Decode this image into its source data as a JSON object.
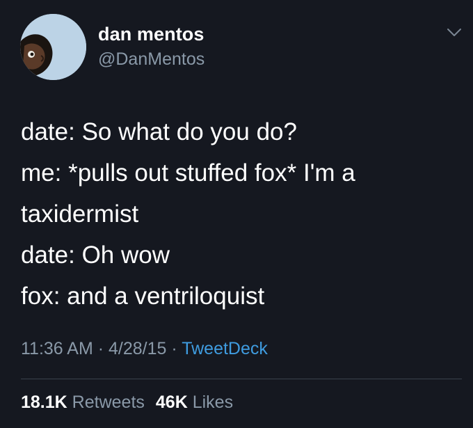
{
  "author": {
    "display_name": "dan mentos",
    "handle": "@DanMentos"
  },
  "tweet": {
    "lines": [
      "date: So what do you do?",
      "me: *pulls out stuffed fox* I'm a",
      "taxidermist",
      "date: Oh wow",
      "fox: and a ventriloquist"
    ]
  },
  "meta": {
    "time": "11:36 AM",
    "separator": "·",
    "date": "4/28/15",
    "source": "TweetDeck"
  },
  "stats": {
    "retweets_count": "18.1K",
    "retweets_label": "Retweets",
    "likes_count": "46K",
    "likes_label": "Likes"
  },
  "colors": {
    "background": "#151820",
    "secondary_text": "#8a99a8",
    "link": "#3f9ce0",
    "avatar_bg": "#bcd3e6"
  },
  "icons": {
    "menu": "chevron-down-icon"
  }
}
